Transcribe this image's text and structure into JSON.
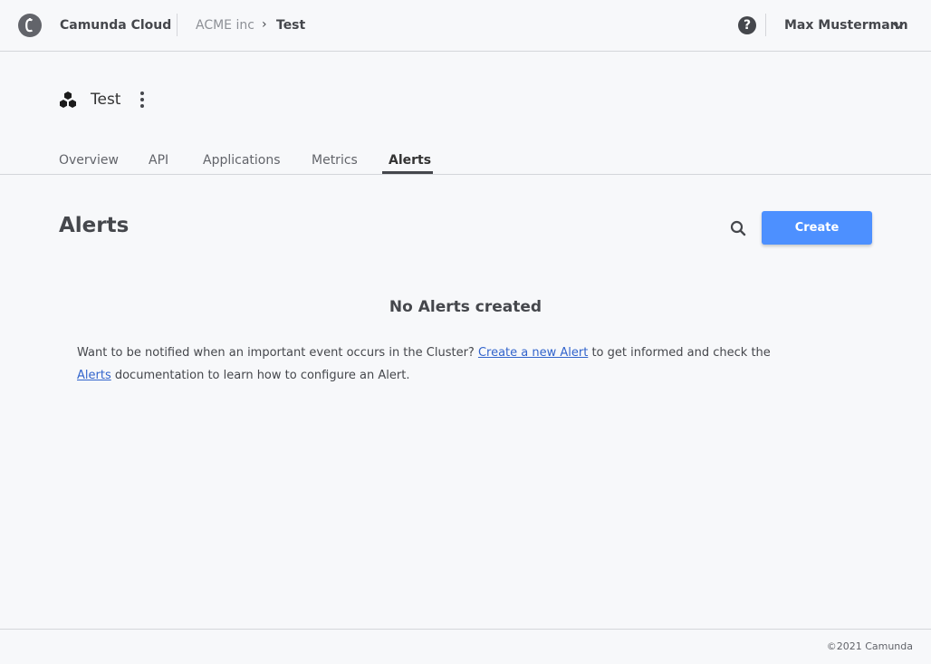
{
  "header": {
    "brand": "Camunda Cloud",
    "breadcrumb": {
      "org": "ACME inc",
      "separator": "›",
      "current": "Test"
    },
    "help_icon": "?",
    "user_name": "Max Mustermann"
  },
  "cluster": {
    "name": "Test"
  },
  "tabs": [
    {
      "label": "Overview"
    },
    {
      "label": "API"
    },
    {
      "label": "Applications"
    },
    {
      "label": "Metrics"
    },
    {
      "label": "Alerts",
      "active": true
    }
  ],
  "main": {
    "title": "Alerts",
    "create_label": "Create",
    "empty_title": "No Alerts created",
    "empty_text": {
      "part1": "Want to be notified when an important event occurs in the Cluster? ",
      "link1": "Create a new Alert",
      "part2": " to get informed and check the ",
      "link2": "Alerts",
      "part3": " documentation to learn how to configure an Alert."
    }
  },
  "footer": {
    "copyright": "©2021 Camunda"
  },
  "colors": {
    "accent": "#4d90ff",
    "link": "#3264cc",
    "text": "#45474c",
    "background": "#f7f8fa"
  },
  "icons": [
    "camunda-logo-icon",
    "help-icon",
    "chevron-down-icon",
    "cluster-icon",
    "kebab-menu-icon",
    "search-icon"
  ]
}
